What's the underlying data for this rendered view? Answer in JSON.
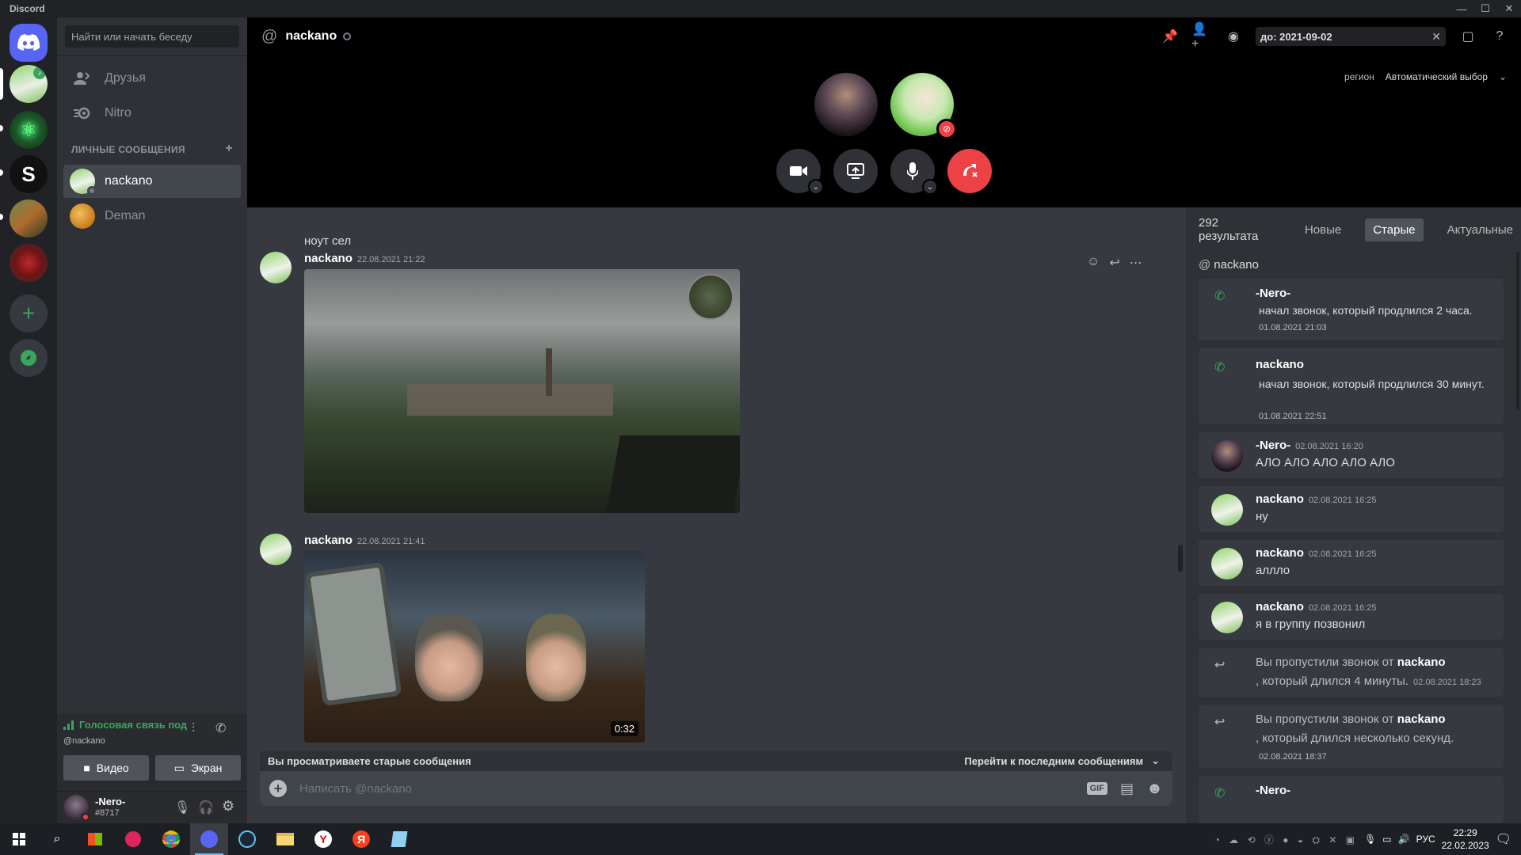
{
  "app": {
    "title": "Discord"
  },
  "sidebar": {
    "search_placeholder": "Найти или начать беседу",
    "nav": [
      {
        "label": "Друзья"
      },
      {
        "label": "Nitro"
      }
    ],
    "dm_header": "ЛИЧНЫЕ СООБЩЕНИЯ",
    "dms": [
      {
        "name": "nackano"
      },
      {
        "name": "Deman"
      }
    ]
  },
  "voice": {
    "status": "Голосовая связь под",
    "sub": "@nackano",
    "video_label": "Видео",
    "screen_label": "Экран"
  },
  "user": {
    "name": "-Nero-",
    "tag": "#8717"
  },
  "header": {
    "channel": "nackano",
    "search_value": "до: 2021-09-02",
    "region_label": "регион",
    "region_value": "Автоматический выбор"
  },
  "chat": {
    "prev_text": "ноут сел",
    "messages": [
      {
        "author": "nackano",
        "time": "22.08.2021 21:22"
      },
      {
        "author": "nackano",
        "time": "22.08.2021 21:41",
        "video_duration": "0:32"
      }
    ],
    "banner_left": "Вы просматриваете старые сообщения",
    "banner_right": "Перейти к последним сообщениям",
    "input_placeholder": "Написать @nackano",
    "gif_label": "GIF"
  },
  "results": {
    "count": "292 результата",
    "tabs": [
      "Новые",
      "Старые",
      "Актуальные"
    ],
    "channel": "nackano",
    "items": [
      {
        "author": "-Nero-",
        "text": "начал звонок, который продлился 2 часа.",
        "date": "01.08.2021 21:03"
      },
      {
        "author": "nackano",
        "text": "начал звонок, который продлился 30 минут.",
        "date": "01.08.2021 22:51"
      },
      {
        "author": "-Nero-",
        "date": "02.08.2021 16:20",
        "text": "АЛО АЛО АЛО АЛО АЛО"
      },
      {
        "author": "nackano",
        "date": "02.08.2021 16:25",
        "text": "ну"
      },
      {
        "author": "nackano",
        "date": "02.08.2021 16:25",
        "text": "аллло"
      },
      {
        "author": "nackano",
        "date": "02.08.2021 16:25",
        "text": "я в группу позвонил"
      },
      {
        "prefix": "Вы пропустили звонок от",
        "author": "nackano",
        "text": ", который длился 4 минуты.",
        "date": "02.08.2021 18:23"
      },
      {
        "prefix": "Вы пропустили звонок от",
        "author": "nackano",
        "text": ", который длился несколько секунд.",
        "date": "02.08.2021 18:37"
      },
      {
        "author": "-Nero-"
      }
    ]
  },
  "taskbar": {
    "lang": "РУС",
    "time": "22:29",
    "date": "22.02.2023"
  },
  "colors": {
    "accent": "#5865f2",
    "green": "#3ba55d",
    "red": "#ed4245",
    "bg_dark": "#202225",
    "bg_mid": "#2f3136",
    "bg_main": "#36393f"
  }
}
